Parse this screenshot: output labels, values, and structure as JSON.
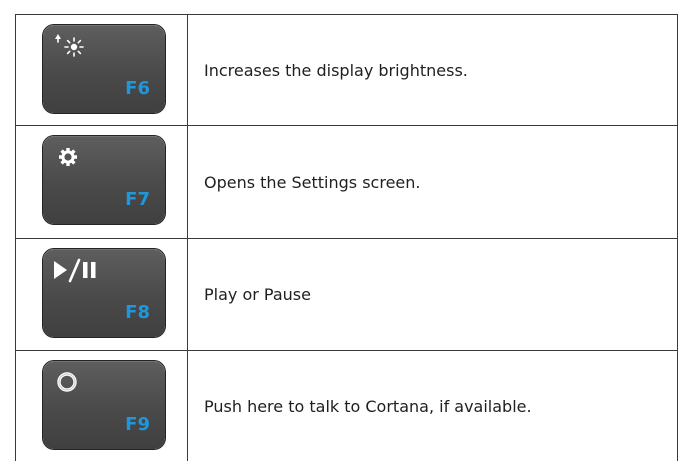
{
  "rows": [
    {
      "key_label": "F6",
      "icon": "brightness-up-icon",
      "description": "Increases the display brightness."
    },
    {
      "key_label": "F7",
      "icon": "gear-icon",
      "description": "Opens the Settings screen."
    },
    {
      "key_label": "F8",
      "icon": "play-pause-icon",
      "description": "Play or Pause"
    },
    {
      "key_label": "F9",
      "icon": "cortana-icon",
      "description": "Push here to talk to Cortana, if available."
    }
  ],
  "colors": {
    "key_body": "#4a4a4a",
    "key_label": "#1f97dd",
    "icon": "#ffffff",
    "text": "#1f1f1f",
    "border": "#3a3a3a"
  }
}
